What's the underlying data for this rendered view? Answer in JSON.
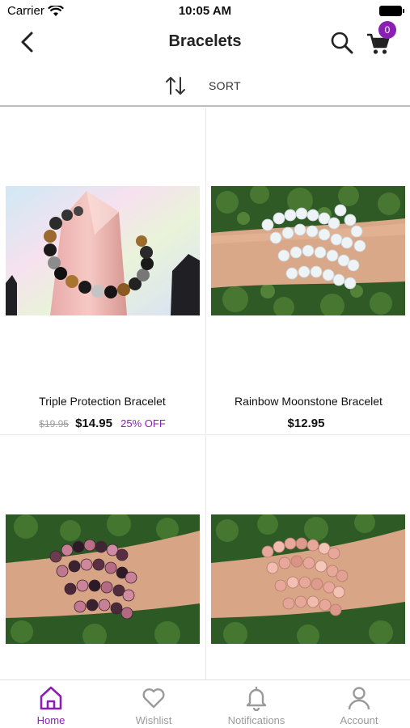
{
  "status_bar": {
    "carrier": "Carrier",
    "time": "10:05 AM"
  },
  "nav": {
    "title": "Bracelets",
    "cart_count": "0"
  },
  "sort": {
    "label": "SORT"
  },
  "products": [
    {
      "name": "Triple Protection Bracelet",
      "old_price": "$19.95",
      "price": "$14.95",
      "discount": "25% OFF"
    },
    {
      "name": "Rainbow Moonstone Bracelet",
      "price": "$12.95"
    },
    {
      "name": ""
    },
    {
      "name": ""
    }
  ],
  "tabs": [
    {
      "label": "Home",
      "icon": "home-icon",
      "active": true
    },
    {
      "label": "Wishlist",
      "icon": "heart-icon"
    },
    {
      "label": "Notifications",
      "icon": "bell-icon"
    },
    {
      "label": "Account",
      "icon": "user-icon"
    }
  ],
  "colors": {
    "accent": "#8a1fb3",
    "muted": "#9a9a9a",
    "divider": "#bdbdbd"
  }
}
